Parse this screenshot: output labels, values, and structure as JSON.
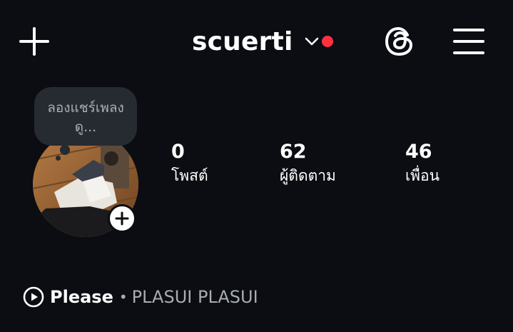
{
  "header": {
    "username": "scuerti",
    "icons": {
      "add": "plus-icon",
      "dropdown": "chevron-down-icon",
      "threads": "threads-icon",
      "menu": "hamburger-menu-icon"
    },
    "notification_dot_color": "#ff3040"
  },
  "profile": {
    "note_placeholder": "ลองแชร์เพลง ดู...",
    "avatar_alt": "avatar",
    "add_story_icon": "plus-icon"
  },
  "stats": [
    {
      "value": "0",
      "label": "โพสต์"
    },
    {
      "value": "62",
      "label": "ผู้ติดตาม"
    },
    {
      "value": "46",
      "label": "เพื่อน"
    }
  ],
  "music": {
    "song": "Please",
    "separator": "•",
    "artist": "PLASUI PLASUI",
    "icon": "play-circle-icon"
  },
  "colors": {
    "background": "#0b0d12",
    "bubble": "#262a31",
    "accent_red": "#ff3040"
  }
}
